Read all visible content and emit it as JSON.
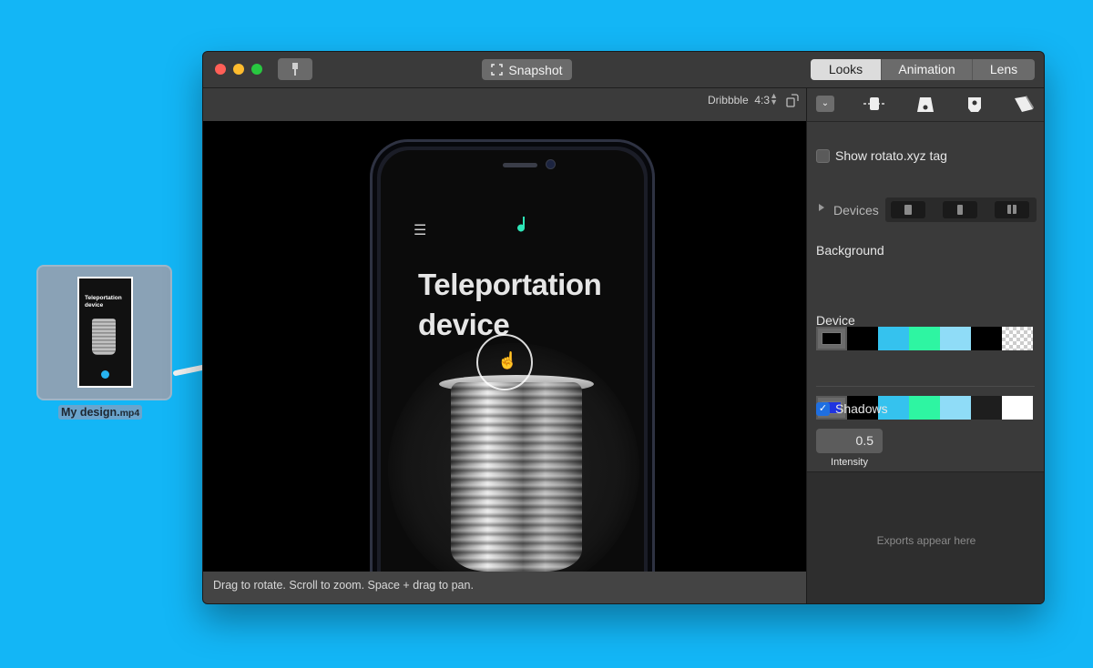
{
  "desktop": {
    "file_name": "My design.",
    "file_ext": "mp4",
    "thumb_title": "Teleportation device"
  },
  "window": {
    "snapshot_label": "Snapshot",
    "tabs": [
      {
        "label": "Looks",
        "active": true
      },
      {
        "label": "Animation",
        "active": false
      },
      {
        "label": "Lens",
        "active": false
      }
    ]
  },
  "canvas": {
    "preset": "Dribbble",
    "aspect": "4:3",
    "headline": "Teleportation device",
    "status_hint": "Drag to rotate. Scroll to zoom. Space + drag to pan."
  },
  "panel": {
    "show_tag_label": "Show rotato.xyz tag",
    "show_tag_checked": false,
    "devices_label": "Devices",
    "background_label": "Background",
    "background_swatches": [
      "#000000",
      "#000000",
      "#35c2ee",
      "#2ef5a2",
      "#8fdcf7",
      "#000000",
      "checker"
    ],
    "device_label": "Device",
    "device_swatches": [
      "#1f33e0",
      "#000000",
      "#35c2ee",
      "#2ef5a2",
      "#8fdcf7",
      "#1e1e1e",
      "#ffffff"
    ],
    "shadows_label": "Shadows",
    "shadows_checked": true,
    "intensity_value": "0.5",
    "intensity_label": "Intensity",
    "exports_placeholder": "Exports appear here"
  }
}
